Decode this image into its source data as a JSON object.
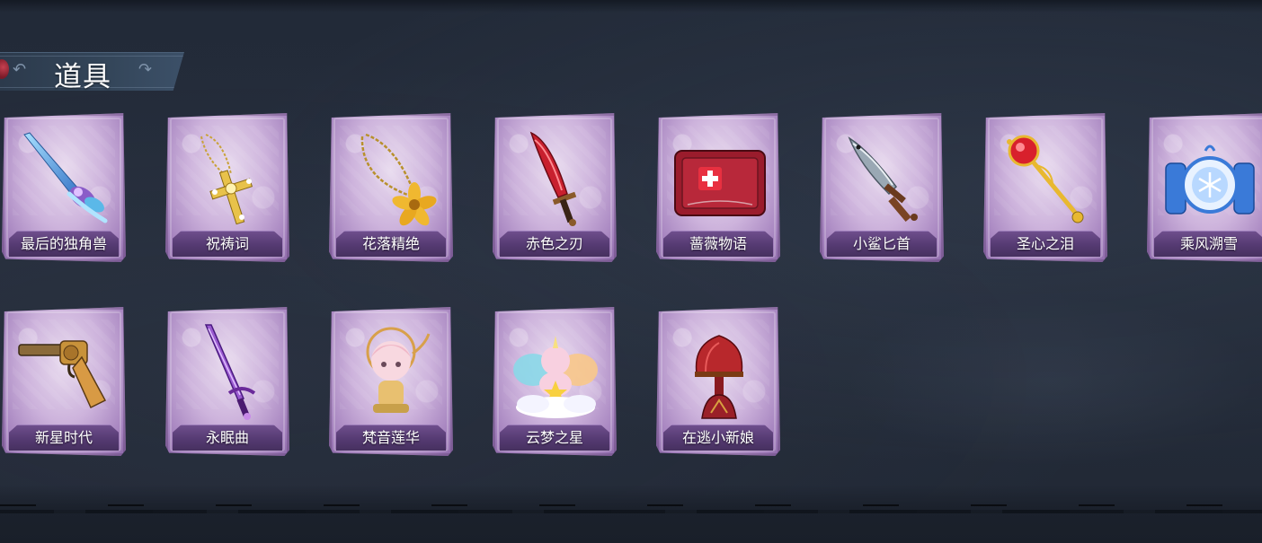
{
  "section": {
    "title": "道具"
  },
  "items": [
    {
      "label": "最后的独角兽",
      "icon": "unicorn-horn-sword-icon"
    },
    {
      "label": "祝祷词",
      "icon": "golden-cross-pendant-icon"
    },
    {
      "label": "花落精绝",
      "icon": "golden-flower-pendant-icon"
    },
    {
      "label": "赤色之刃",
      "icon": "red-blade-icon"
    },
    {
      "label": "蔷薇物语",
      "icon": "red-medkit-icon"
    },
    {
      "label": "小鲨匕首",
      "icon": "shark-dagger-icon"
    },
    {
      "label": "圣心之泪",
      "icon": "ruby-scepter-icon"
    },
    {
      "label": "乘风溯雪",
      "icon": "snow-lantern-icon"
    },
    {
      "label": "新星时代",
      "icon": "golden-revolver-icon"
    },
    {
      "label": "永眠曲",
      "icon": "purple-rapier-icon"
    },
    {
      "label": "梵音莲华",
      "icon": "chibi-figure-icon"
    },
    {
      "label": "云梦之星",
      "icon": "cloud-unicorn-icon"
    },
    {
      "label": "在逃小新娘",
      "icon": "red-lamp-icon"
    }
  ],
  "colors": {
    "background": "#232b39",
    "card": "#c9aed8",
    "label_plate": "#553a72"
  }
}
